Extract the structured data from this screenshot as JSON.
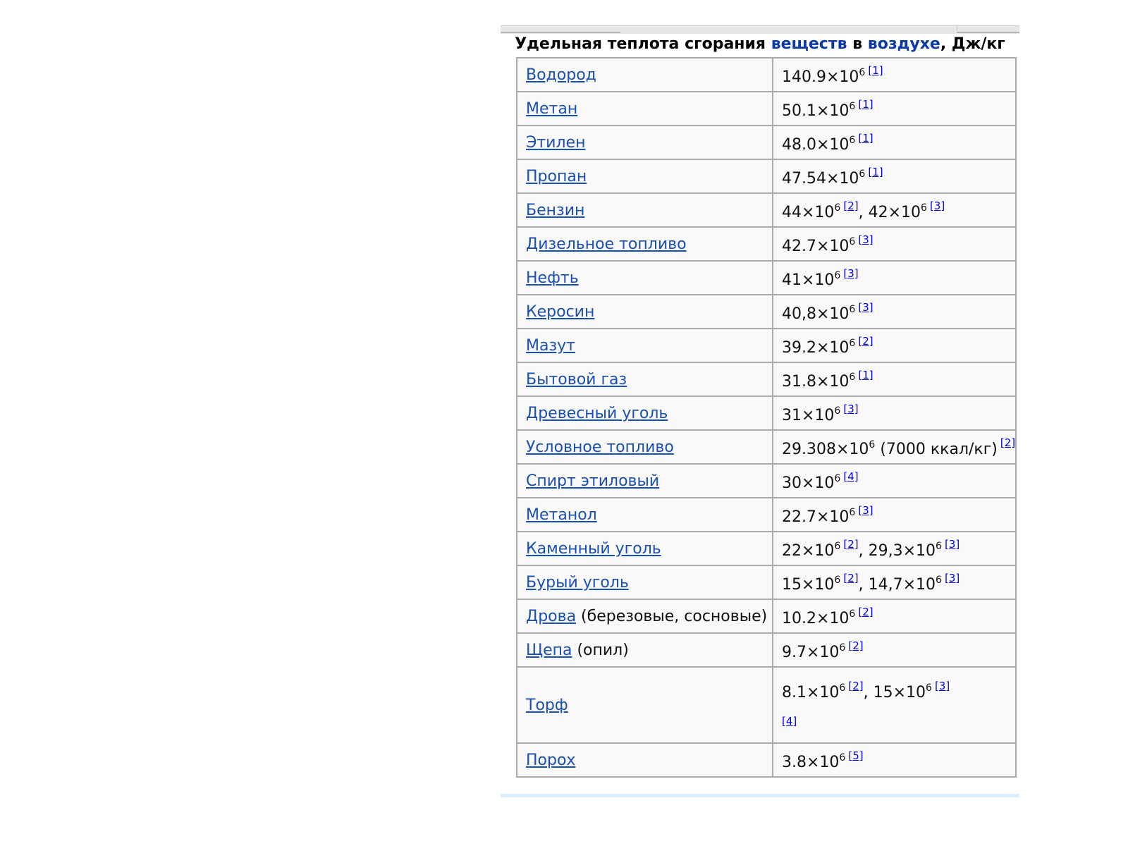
{
  "caption": {
    "prefix": "Удельная теплота сгорания ",
    "link1": "веществ",
    "middle": " в ",
    "link2": "воздухе",
    "suffix": ", Дж/кг"
  },
  "colors": {
    "link": "#1a4fb3",
    "border": "#aaaaaa",
    "cell_bg": "#f9f9f9"
  },
  "rows": [
    {
      "name": "Водород",
      "v1": "140.9×10",
      "e1": "6",
      "r1": "[1]"
    },
    {
      "name": "Метан",
      "v1": "50.1×10",
      "e1": "6",
      "r1": "[1]"
    },
    {
      "name": "Этилен",
      "v1": "48.0×10",
      "e1": "6",
      "r1": "[1]"
    },
    {
      "name": "Пропан",
      "v1": "47.54×10",
      "e1": "6",
      "r1": "[1]"
    },
    {
      "name": "Бензин",
      "v1": "44×10",
      "e1": "6",
      "r1": "[2]",
      "sep": ", ",
      "v2": "42×10",
      "e2": "6",
      "r2": "[3]"
    },
    {
      "name": "Дизельное топливо",
      "v1": "42.7×10",
      "e1": "6",
      "r1": "[3]"
    },
    {
      "name": "Нефть",
      "v1": "41×10",
      "e1": "6",
      "r1": "[3]"
    },
    {
      "name": "Керосин",
      "v1": "40,8×10",
      "e1": "6",
      "r1": "[3]"
    },
    {
      "name": "Мазут",
      "v1": "39.2×10",
      "e1": "6",
      "r1": "[2]"
    },
    {
      "name": "Бытовой газ",
      "v1": "31.8×10",
      "e1": "6",
      "r1": "[1]"
    },
    {
      "name": "Древесный уголь",
      "v1": "31×10",
      "e1": "6",
      "r1": "[3]"
    },
    {
      "name": "Условное топливо",
      "v1": "29.308×10",
      "e1": "6",
      "tail": " (7000 ккал/кг)",
      "r1": "[2]"
    },
    {
      "name": "Спирт этиловый",
      "v1": "30×10",
      "e1": "6",
      "r1": "[4]"
    },
    {
      "name": "Метанол",
      "v1": "22.7×10",
      "e1": "6",
      "r1": "[3]"
    },
    {
      "name": "Каменный уголь",
      "v1": "22×10",
      "e1": "6",
      "r1": "[2]",
      "sep": ", ",
      "v2": "29,3×10",
      "e2": "6",
      "r2": "[3]"
    },
    {
      "name": "Бурый уголь",
      "v1": "15×10",
      "e1": "6",
      "r1": "[2]",
      "sep": ", ",
      "v2": "14,7×10",
      "e2": "6",
      "r2": "[3]"
    },
    {
      "name": "Дрова",
      "note": " (березовые, сосновые)",
      "v1": "10.2×10",
      "e1": "6",
      "r1": "[2]"
    },
    {
      "name": "Щепа",
      "note": " (опил)",
      "v1": "9.7×10",
      "e1": "6",
      "r1": "[2]"
    },
    {
      "name": "Торф",
      "v1": "8.1×10",
      "e1": "6",
      "r1": "[2]",
      "sep": ", ",
      "v2": "15×10",
      "e2": "6",
      "r2": "[3]",
      "r3": "[4]"
    },
    {
      "name": "Порох",
      "v1": "3.8×10",
      "e1": "6",
      "r1": "[5]"
    }
  ]
}
